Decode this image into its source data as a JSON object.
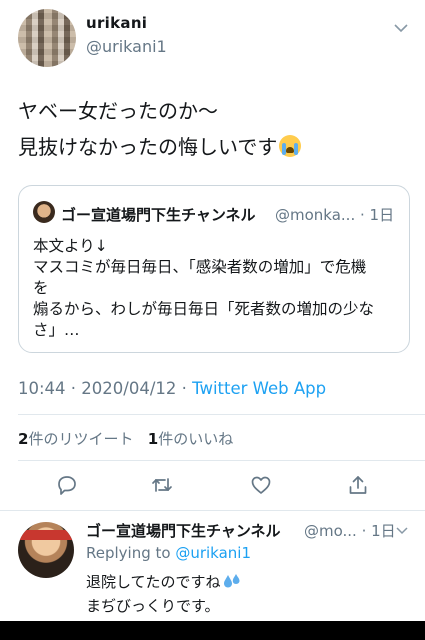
{
  "tweet": {
    "user": {
      "name": "urikani",
      "handle": "@urikani1"
    },
    "text_lines": [
      "ヤベー女だったのか〜",
      "見抜けなかったの悔しいです"
    ],
    "emoji": "loudly-crying-face",
    "quote": {
      "name": "ゴー宣道場門下生チャンネル",
      "meta": "@monka... · 1日",
      "body_lines": [
        "本文より↓",
        "マスコミが毎日毎日、「感染者数の増加」で危機",
        "を",
        "煽るから、わしが毎日毎日「死者数の増加の少な",
        "さ」…"
      ]
    },
    "time": "10:44 · 2020/04/12 · ",
    "app": "Twitter Web App",
    "stats": {
      "retweet_count": "2",
      "retweet_label": "件のリツイート",
      "like_count": "1",
      "like_label": "件のいいね"
    },
    "actions": [
      "reply-icon",
      "retweet-icon",
      "like-icon",
      "share-icon"
    ]
  },
  "reply": {
    "name": "ゴー宣道場門下生チャンネル",
    "meta": "@mo... · 1日",
    "replying_prefix": "Replying to ",
    "replying_mention": "@urikani1",
    "text_lines": [
      "退院してたのですね",
      "まぢびっくりです。"
    ],
    "emoji": "sweat-droplets"
  },
  "colors": {
    "link": "#1da1f2",
    "secondary": "#657786",
    "text": "#14171a",
    "border": "#e1e8ed"
  }
}
